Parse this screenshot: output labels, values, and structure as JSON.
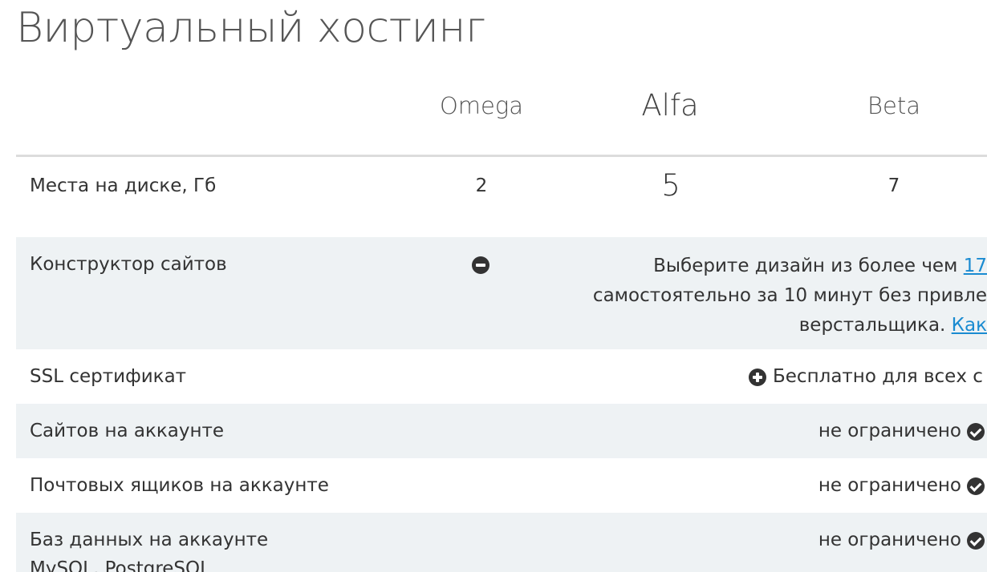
{
  "page": {
    "title": "Виртуальный хостинг"
  },
  "plans": [
    {
      "name": "Omega"
    },
    {
      "name": "Alfa"
    },
    {
      "name": "Beta"
    }
  ],
  "rows": {
    "disk": {
      "label": "Места на диске, Гб",
      "values": [
        "2",
        "5",
        "7"
      ]
    },
    "builder": {
      "label": "Конструктор сайтов",
      "omega_icon": "minus-circle-icon",
      "line1": "Выберите дизайн из более чем ",
      "line1_link": "17",
      "line2": "самостоятельно за 10 минут без привле",
      "line3": "верстальщика. ",
      "line3_link": "Как"
    },
    "ssl": {
      "label": "SSL сертификат",
      "icon": "plus-circle-icon",
      "value": "Бесплатно для всех с"
    },
    "sites": {
      "label": "Сайтов на аккаунте",
      "value": "не ограничено",
      "icon": "check-circle-icon"
    },
    "mailboxes": {
      "label": "Почтовых ящиков на аккаунте",
      "value": "не ограничено",
      "icon": "check-circle-icon"
    },
    "databases": {
      "label": "Баз данных на аккаунте",
      "sublabel": "MySQL, PostgreSQL",
      "value": "не ограничено",
      "icon": "check-circle-icon"
    }
  },
  "colors": {
    "alt_row_bg": "#eef2f4",
    "link": "#1a8bd1",
    "divider": "#dcdcdc"
  }
}
